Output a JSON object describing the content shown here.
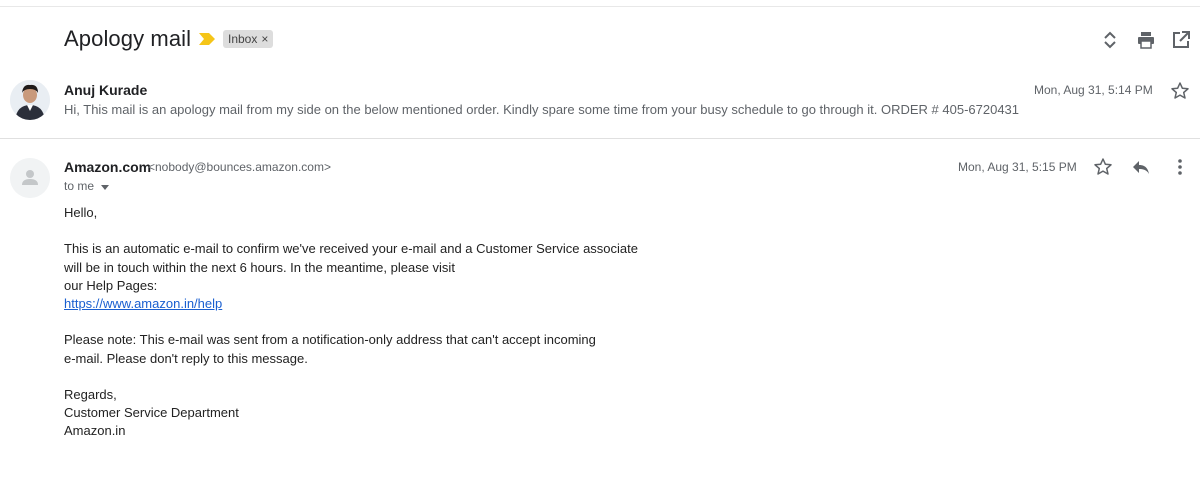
{
  "thread": {
    "subject": "Apology mail",
    "label": "Inbox",
    "label_close": "×",
    "toolbar_icons": [
      "expand-collapse-icon",
      "print-icon",
      "open-in-new-window-icon"
    ]
  },
  "messages": [
    {
      "sender_name": "Anuj Kurade",
      "snippet": "Hi, This mail is an apology mail from my side on the below mentioned order. Kindly spare some time from your busy schedule to go through it. ORDER # 405-6720431",
      "date": "Mon, Aug 31, 5:14 PM"
    },
    {
      "sender_name": "Amazon.com",
      "sender_email": "<nobody@bounces.amazon.com>",
      "to": "to me",
      "date": "Mon, Aug 31, 5:15 PM",
      "body": {
        "greeting": "Hello,",
        "para1_line1": "This is an automatic e-mail to confirm we've received your e-mail and a Customer Service associate",
        "para1_line2": "will be in touch within the next 6 hours. In the meantime, please visit",
        "para1_line3": "our Help Pages:",
        "help_link": "https://www.amazon.in/help",
        "para2_line1": "Please note: This e-mail was sent from a notification-only address that can't accept incoming",
        "para2_line2": "e-mail. Please don't reply to this message.",
        "sign1": "Regards,",
        "sign2": "Customer Service Department",
        "sign3": "Amazon.in"
      }
    }
  ],
  "colors": {
    "importance_marker": "#f5c518",
    "link": "#1a5fd0",
    "label_chip_bg": "#dddddd"
  }
}
